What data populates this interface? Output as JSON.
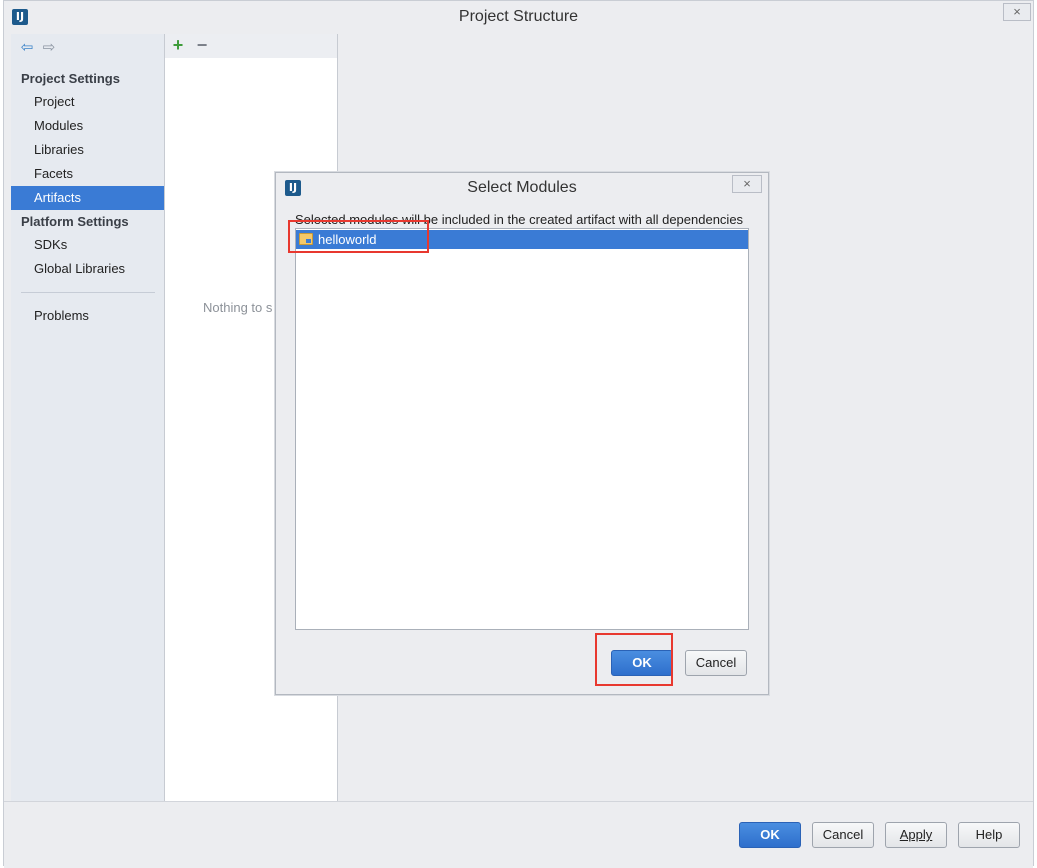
{
  "window": {
    "title": "Project Structure",
    "logo_icon": "intellij-logo-icon",
    "close_glyph": "×"
  },
  "nav": {
    "back_icon": "arrow-left-icon",
    "forward_icon": "arrow-right-icon"
  },
  "sidebar": {
    "project_settings_header": "Project Settings",
    "project_settings_items": [
      "Project",
      "Modules",
      "Libraries",
      "Facets",
      "Artifacts"
    ],
    "selected_item": "Artifacts",
    "platform_settings_header": "Platform Settings",
    "platform_settings_items": [
      "SDKs",
      "Global Libraries"
    ],
    "problems": "Problems"
  },
  "artifacts_panel": {
    "add_glyph": "+",
    "remove_glyph": "−",
    "empty_text": "Nothing to s"
  },
  "dialog": {
    "title": "Select Modules",
    "description": "Selected modules will be included in the created artifact with all dependencies",
    "modules": [
      "helloworld"
    ],
    "ok_label": "OK",
    "cancel_label": "Cancel",
    "close_glyph": "×"
  },
  "footer": {
    "ok_label": "OK",
    "cancel_label": "Cancel",
    "apply_label": "Apply",
    "help_label": "Help"
  },
  "colors": {
    "selection": "#3a7bd5",
    "highlight_border": "#e8382f",
    "add_green": "#3e9c3a"
  }
}
